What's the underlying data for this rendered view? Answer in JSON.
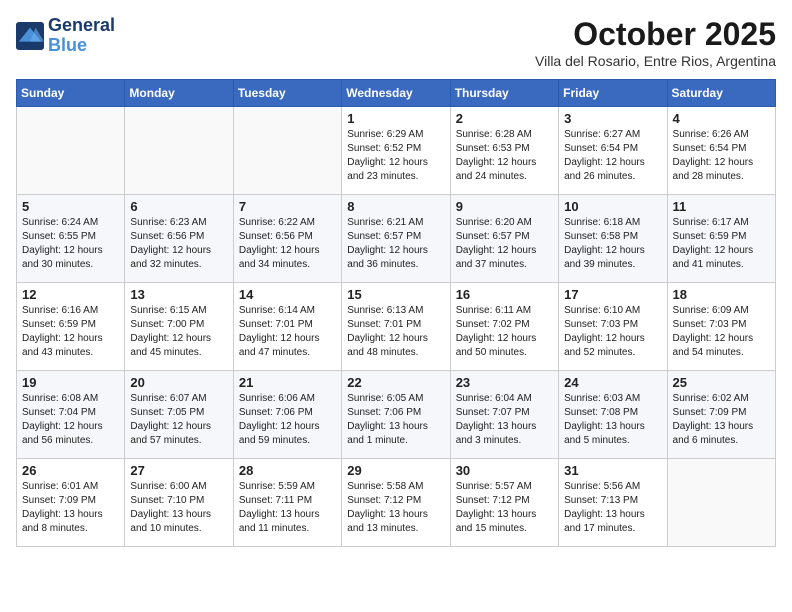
{
  "header": {
    "logo_line1": "General",
    "logo_line2": "Blue",
    "month": "October 2025",
    "location": "Villa del Rosario, Entre Rios, Argentina"
  },
  "weekdays": [
    "Sunday",
    "Monday",
    "Tuesday",
    "Wednesday",
    "Thursday",
    "Friday",
    "Saturday"
  ],
  "weeks": [
    [
      {
        "day": "",
        "info": ""
      },
      {
        "day": "",
        "info": ""
      },
      {
        "day": "",
        "info": ""
      },
      {
        "day": "1",
        "info": "Sunrise: 6:29 AM\nSunset: 6:52 PM\nDaylight: 12 hours\nand 23 minutes."
      },
      {
        "day": "2",
        "info": "Sunrise: 6:28 AM\nSunset: 6:53 PM\nDaylight: 12 hours\nand 24 minutes."
      },
      {
        "day": "3",
        "info": "Sunrise: 6:27 AM\nSunset: 6:54 PM\nDaylight: 12 hours\nand 26 minutes."
      },
      {
        "day": "4",
        "info": "Sunrise: 6:26 AM\nSunset: 6:54 PM\nDaylight: 12 hours\nand 28 minutes."
      }
    ],
    [
      {
        "day": "5",
        "info": "Sunrise: 6:24 AM\nSunset: 6:55 PM\nDaylight: 12 hours\nand 30 minutes."
      },
      {
        "day": "6",
        "info": "Sunrise: 6:23 AM\nSunset: 6:56 PM\nDaylight: 12 hours\nand 32 minutes."
      },
      {
        "day": "7",
        "info": "Sunrise: 6:22 AM\nSunset: 6:56 PM\nDaylight: 12 hours\nand 34 minutes."
      },
      {
        "day": "8",
        "info": "Sunrise: 6:21 AM\nSunset: 6:57 PM\nDaylight: 12 hours\nand 36 minutes."
      },
      {
        "day": "9",
        "info": "Sunrise: 6:20 AM\nSunset: 6:57 PM\nDaylight: 12 hours\nand 37 minutes."
      },
      {
        "day": "10",
        "info": "Sunrise: 6:18 AM\nSunset: 6:58 PM\nDaylight: 12 hours\nand 39 minutes."
      },
      {
        "day": "11",
        "info": "Sunrise: 6:17 AM\nSunset: 6:59 PM\nDaylight: 12 hours\nand 41 minutes."
      }
    ],
    [
      {
        "day": "12",
        "info": "Sunrise: 6:16 AM\nSunset: 6:59 PM\nDaylight: 12 hours\nand 43 minutes."
      },
      {
        "day": "13",
        "info": "Sunrise: 6:15 AM\nSunset: 7:00 PM\nDaylight: 12 hours\nand 45 minutes."
      },
      {
        "day": "14",
        "info": "Sunrise: 6:14 AM\nSunset: 7:01 PM\nDaylight: 12 hours\nand 47 minutes."
      },
      {
        "day": "15",
        "info": "Sunrise: 6:13 AM\nSunset: 7:01 PM\nDaylight: 12 hours\nand 48 minutes."
      },
      {
        "day": "16",
        "info": "Sunrise: 6:11 AM\nSunset: 7:02 PM\nDaylight: 12 hours\nand 50 minutes."
      },
      {
        "day": "17",
        "info": "Sunrise: 6:10 AM\nSunset: 7:03 PM\nDaylight: 12 hours\nand 52 minutes."
      },
      {
        "day": "18",
        "info": "Sunrise: 6:09 AM\nSunset: 7:03 PM\nDaylight: 12 hours\nand 54 minutes."
      }
    ],
    [
      {
        "day": "19",
        "info": "Sunrise: 6:08 AM\nSunset: 7:04 PM\nDaylight: 12 hours\nand 56 minutes."
      },
      {
        "day": "20",
        "info": "Sunrise: 6:07 AM\nSunset: 7:05 PM\nDaylight: 12 hours\nand 57 minutes."
      },
      {
        "day": "21",
        "info": "Sunrise: 6:06 AM\nSunset: 7:06 PM\nDaylight: 12 hours\nand 59 minutes."
      },
      {
        "day": "22",
        "info": "Sunrise: 6:05 AM\nSunset: 7:06 PM\nDaylight: 13 hours\nand 1 minute."
      },
      {
        "day": "23",
        "info": "Sunrise: 6:04 AM\nSunset: 7:07 PM\nDaylight: 13 hours\nand 3 minutes."
      },
      {
        "day": "24",
        "info": "Sunrise: 6:03 AM\nSunset: 7:08 PM\nDaylight: 13 hours\nand 5 minutes."
      },
      {
        "day": "25",
        "info": "Sunrise: 6:02 AM\nSunset: 7:09 PM\nDaylight: 13 hours\nand 6 minutes."
      }
    ],
    [
      {
        "day": "26",
        "info": "Sunrise: 6:01 AM\nSunset: 7:09 PM\nDaylight: 13 hours\nand 8 minutes."
      },
      {
        "day": "27",
        "info": "Sunrise: 6:00 AM\nSunset: 7:10 PM\nDaylight: 13 hours\nand 10 minutes."
      },
      {
        "day": "28",
        "info": "Sunrise: 5:59 AM\nSunset: 7:11 PM\nDaylight: 13 hours\nand 11 minutes."
      },
      {
        "day": "29",
        "info": "Sunrise: 5:58 AM\nSunset: 7:12 PM\nDaylight: 13 hours\nand 13 minutes."
      },
      {
        "day": "30",
        "info": "Sunrise: 5:57 AM\nSunset: 7:12 PM\nDaylight: 13 hours\nand 15 minutes."
      },
      {
        "day": "31",
        "info": "Sunrise: 5:56 AM\nSunset: 7:13 PM\nDaylight: 13 hours\nand 17 minutes."
      },
      {
        "day": "",
        "info": ""
      }
    ]
  ]
}
